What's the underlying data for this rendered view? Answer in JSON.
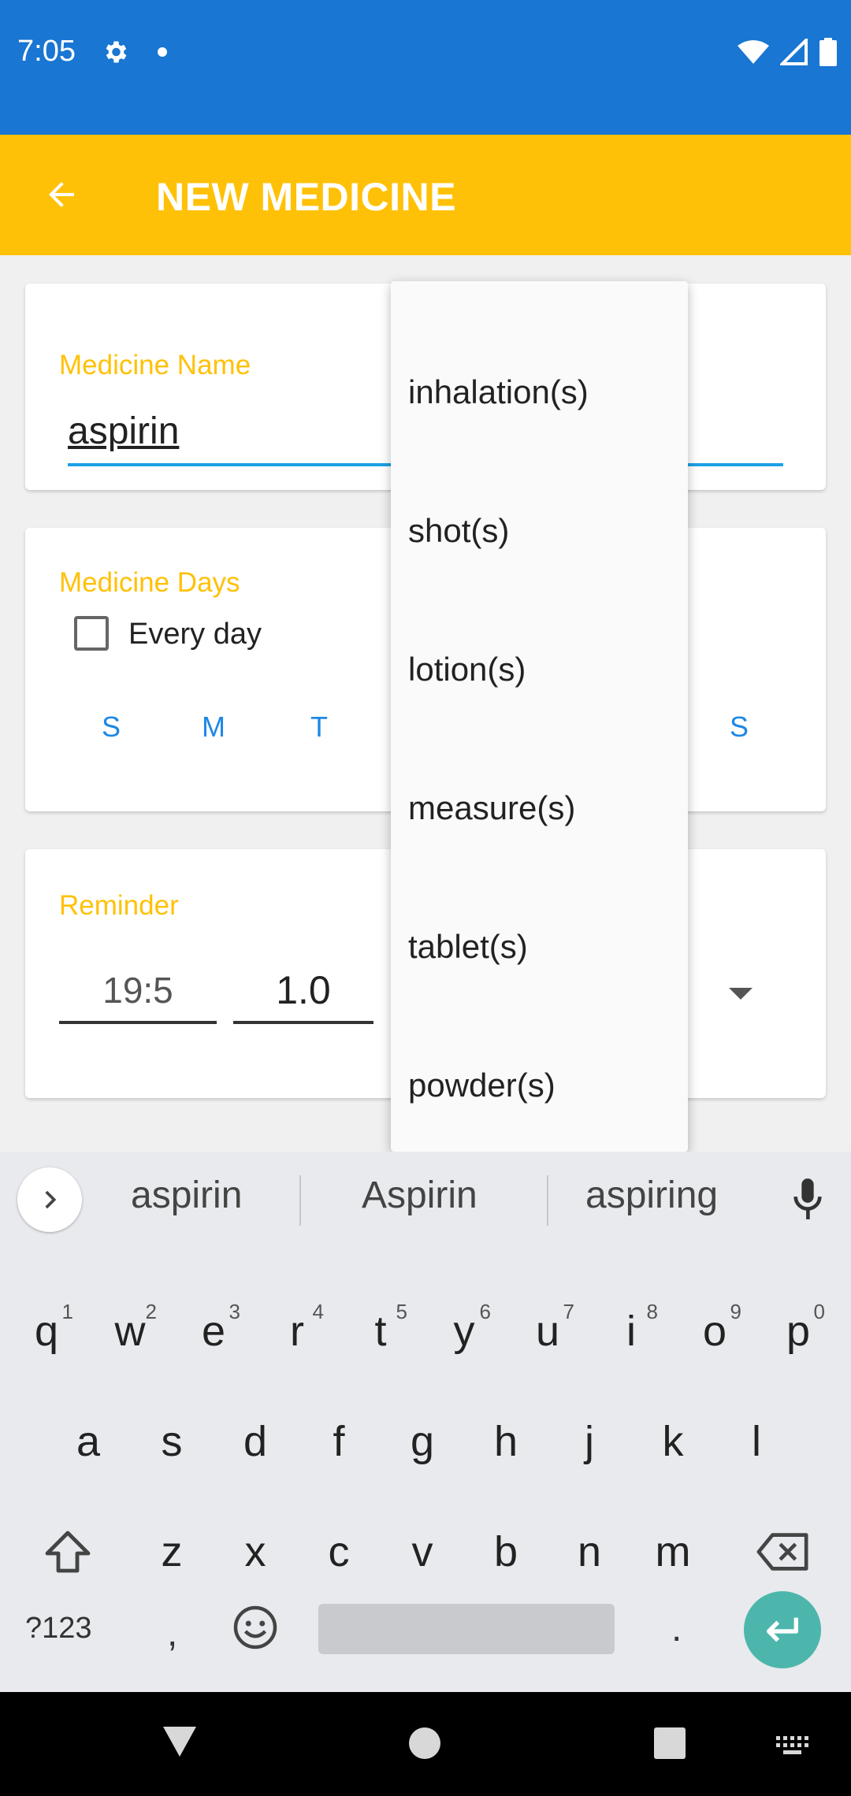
{
  "status_bar": {
    "time": "7:05"
  },
  "app_bar": {
    "title": "NEW MEDICINE"
  },
  "name_card": {
    "label": "Medicine Name",
    "value": "aspirin"
  },
  "days_card": {
    "label": "Medicine Days",
    "every_day_label": "Every day",
    "days": [
      "S",
      "M",
      "T",
      "S"
    ]
  },
  "reminder_card": {
    "label": "Reminder",
    "time": "19:5",
    "quantity": "1.0"
  },
  "dropdown": {
    "items": [
      "inhalation(s)",
      "shot(s)",
      "lotion(s)",
      "measure(s)",
      "tablet(s)",
      "powder(s)"
    ]
  },
  "suggestions": [
    "aspirin",
    "Aspirin",
    "aspiring"
  ],
  "keyboard": {
    "row1": [
      "q",
      "w",
      "e",
      "r",
      "t",
      "y",
      "u",
      "i",
      "o",
      "p"
    ],
    "row1_hints": [
      "1",
      "2",
      "3",
      "4",
      "5",
      "6",
      "7",
      "8",
      "9",
      "0"
    ],
    "row2": [
      "a",
      "s",
      "d",
      "f",
      "g",
      "h",
      "j",
      "k",
      "l"
    ],
    "row3": [
      "z",
      "x",
      "c",
      "v",
      "b",
      "n",
      "m"
    ],
    "symbols_label": "?123",
    "comma": ",",
    "period": "."
  },
  "colors": {
    "status_bar": "#1976d2",
    "app_bar": "#ffc107",
    "accent_blue": "#1ea0e6",
    "enter_key": "#4db6ac"
  }
}
